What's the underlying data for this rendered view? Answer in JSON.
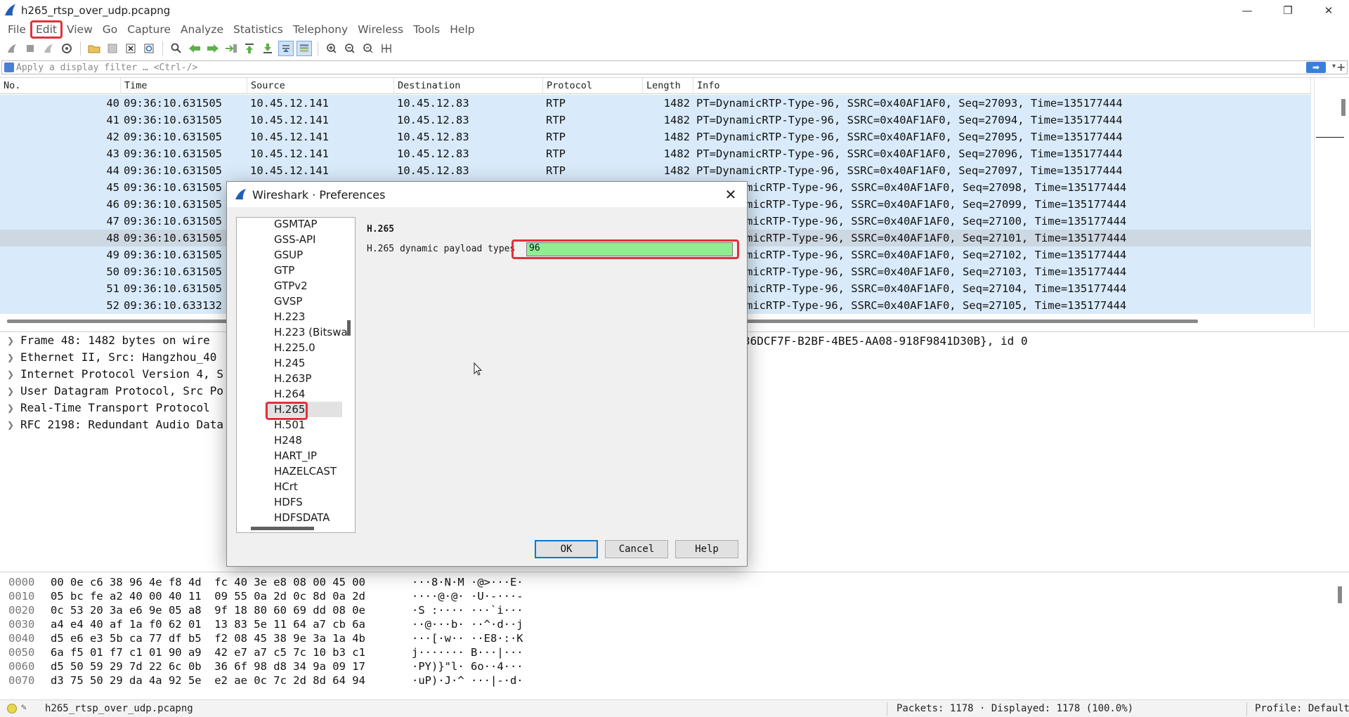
{
  "window": {
    "title": "h265_rtsp_over_udp.pcapng",
    "minimize": "—",
    "maximize": "❐",
    "close": "✕"
  },
  "menu": [
    "File",
    "Edit",
    "View",
    "Go",
    "Capture",
    "Analyze",
    "Statistics",
    "Telephony",
    "Wireless",
    "Tools",
    "Help"
  ],
  "highlighted_menu": "Edit",
  "filter": {
    "placeholder": "Apply a display filter … <Ctrl-/>",
    "apply_icon": "arrow-right-icon",
    "dropdown_icon": "▾",
    "add_icon": "+"
  },
  "packet_list": {
    "columns": [
      "No.",
      "Time",
      "Source",
      "Destination",
      "Protocol",
      "Length",
      "Info"
    ],
    "rows": [
      {
        "no": "40",
        "time": "09:36:10.631505",
        "src": "10.45.12.141",
        "dst": "10.45.12.83",
        "proto": "RTP",
        "len": "1482",
        "info": "PT=DynamicRTP-Type-96, SSRC=0x40AF1AF0, Seq=27093, Time=135177444"
      },
      {
        "no": "41",
        "time": "09:36:10.631505",
        "src": "10.45.12.141",
        "dst": "10.45.12.83",
        "proto": "RTP",
        "len": "1482",
        "info": "PT=DynamicRTP-Type-96, SSRC=0x40AF1AF0, Seq=27094, Time=135177444"
      },
      {
        "no": "42",
        "time": "09:36:10.631505",
        "src": "10.45.12.141",
        "dst": "10.45.12.83",
        "proto": "RTP",
        "len": "1482",
        "info": "PT=DynamicRTP-Type-96, SSRC=0x40AF1AF0, Seq=27095, Time=135177444"
      },
      {
        "no": "43",
        "time": "09:36:10.631505",
        "src": "10.45.12.141",
        "dst": "10.45.12.83",
        "proto": "RTP",
        "len": "1482",
        "info": "PT=DynamicRTP-Type-96, SSRC=0x40AF1AF0, Seq=27096, Time=135177444"
      },
      {
        "no": "44",
        "time": "09:36:10.631505",
        "src": "10.45.12.141",
        "dst": "10.45.12.83",
        "proto": "RTP",
        "len": "1482",
        "info": "PT=DynamicRTP-Type-96, SSRC=0x40AF1AF0, Seq=27097, Time=135177444"
      },
      {
        "no": "45",
        "time": "09:36:10.631505",
        "src": "",
        "dst": "",
        "proto": "",
        "len": "",
        "info": "micRTP-Type-96, SSRC=0x40AF1AF0, Seq=27098, Time=135177444"
      },
      {
        "no": "46",
        "time": "09:36:10.631505",
        "src": "",
        "dst": "",
        "proto": "",
        "len": "",
        "info": "micRTP-Type-96, SSRC=0x40AF1AF0, Seq=27099, Time=135177444"
      },
      {
        "no": "47",
        "time": "09:36:10.631505",
        "src": "",
        "dst": "",
        "proto": "",
        "len": "",
        "info": "micRTP-Type-96, SSRC=0x40AF1AF0, Seq=27100, Time=135177444"
      },
      {
        "no": "48",
        "time": "09:36:10.631505",
        "src": "",
        "dst": "",
        "proto": "",
        "len": "",
        "info": "micRTP-Type-96, SSRC=0x40AF1AF0, Seq=27101, Time=135177444",
        "selected": true
      },
      {
        "no": "49",
        "time": "09:36:10.631505",
        "src": "",
        "dst": "",
        "proto": "",
        "len": "",
        "info": "micRTP-Type-96, SSRC=0x40AF1AF0, Seq=27102, Time=135177444"
      },
      {
        "no": "50",
        "time": "09:36:10.631505",
        "src": "",
        "dst": "",
        "proto": "",
        "len": "",
        "info": "micRTP-Type-96, SSRC=0x40AF1AF0, Seq=27103, Time=135177444"
      },
      {
        "no": "51",
        "time": "09:36:10.631505",
        "src": "",
        "dst": "",
        "proto": "",
        "len": "",
        "info": "micRTP-Type-96, SSRC=0x40AF1AF0, Seq=27104, Time=135177444"
      },
      {
        "no": "52",
        "time": "09:36:10.633132",
        "src": "",
        "dst": "",
        "proto": "",
        "len": "",
        "info": "micRTP-Type-96, SSRC=0x40AF1AF0, Seq=27105, Time=135177444"
      }
    ]
  },
  "details": {
    "rows": [
      "Frame 48: 1482 bytes on wire",
      "Ethernet II, Src: Hangzhou_40",
      "Internet Protocol Version 4, S",
      "User Datagram Protocol, Src Po",
      "Real-Time Transport Protocol",
      "RFC 2198: Redundant Audio Data"
    ],
    "frame_tail": "36DCF7F-B2BF-4BE5-AA08-918F9841D30B}, id 0"
  },
  "bytes": [
    {
      "off": "0000",
      "hex": "00 0e c6 38 96 4e f8 4d  fc 40 3e e8 08 00 45 00",
      "ascii": "···8·N·M ·@>···E·"
    },
    {
      "off": "0010",
      "hex": "05 bc fe a2 40 00 40 11  09 55 0a 2d 0c 8d 0a 2d",
      "ascii": "····@·@· ·U·-···-"
    },
    {
      "off": "0020",
      "hex": "0c 53 20 3a e6 9e 05 a8  9f 18 80 60 69 dd 08 0e",
      "ascii": "·S :···· ···`i···"
    },
    {
      "off": "0030",
      "hex": "a4 e4 40 af 1a f0 62 01  13 83 5e 11 64 a7 cb 6a",
      "ascii": "··@···b· ··^·d··j"
    },
    {
      "off": "0040",
      "hex": "d5 e6 e3 5b ca 77 df b5  f2 08 45 38 9e 3a 1a 4b",
      "ascii": "···[·w·· ··E8·:·K"
    },
    {
      "off": "0050",
      "hex": "6a f5 01 f7 c1 01 90 a9  42 e7 a7 c5 7c 10 b3 c1",
      "ascii": "j······· B···|···"
    },
    {
      "off": "0060",
      "hex": "d5 50 59 29 7d 22 6c 0b  36 6f 98 d8 34 9a 09 17",
      "ascii": "·PY)}\"l· 6o··4···"
    },
    {
      "off": "0070",
      "hex": "d3 75 50 29 da 4a 92 5e  e2 ae 0c 7c 2d 8d 64 94",
      "ascii": "·uP)·J·^ ···|-·d·"
    }
  ],
  "status": {
    "filename": "h265_rtsp_over_udp.pcapng",
    "packets": "Packets: 1178 · Displayed: 1178 (100.0%)",
    "profile": "Profile: Default"
  },
  "dialog": {
    "title": "Wireshark · Preferences",
    "close": "✕",
    "protocols": [
      "GSMTAP",
      "GSS-API",
      "GSUP",
      "GTP",
      "GTPv2",
      "GVSP",
      "H.223",
      "H.223 (Bitswa",
      "H.225.0",
      "H.245",
      "H.263P",
      "H.264",
      "H.265",
      "H.501",
      "H248",
      "HART_IP",
      "HAZELCAST",
      "HCrt",
      "HDFS",
      "HDFSDATA"
    ],
    "selected_protocol": "H.265",
    "panel_title": "H.265",
    "field_label": "H.265 dynamic payload types",
    "field_value": "96",
    "field_color": "#90ee90",
    "ok": "OK",
    "cancel": "Cancel",
    "help": "Help"
  },
  "colors": {
    "highlight": "#e0323c",
    "row_bg": "#d9ebfa",
    "row_selected": "#cdd8e2"
  }
}
